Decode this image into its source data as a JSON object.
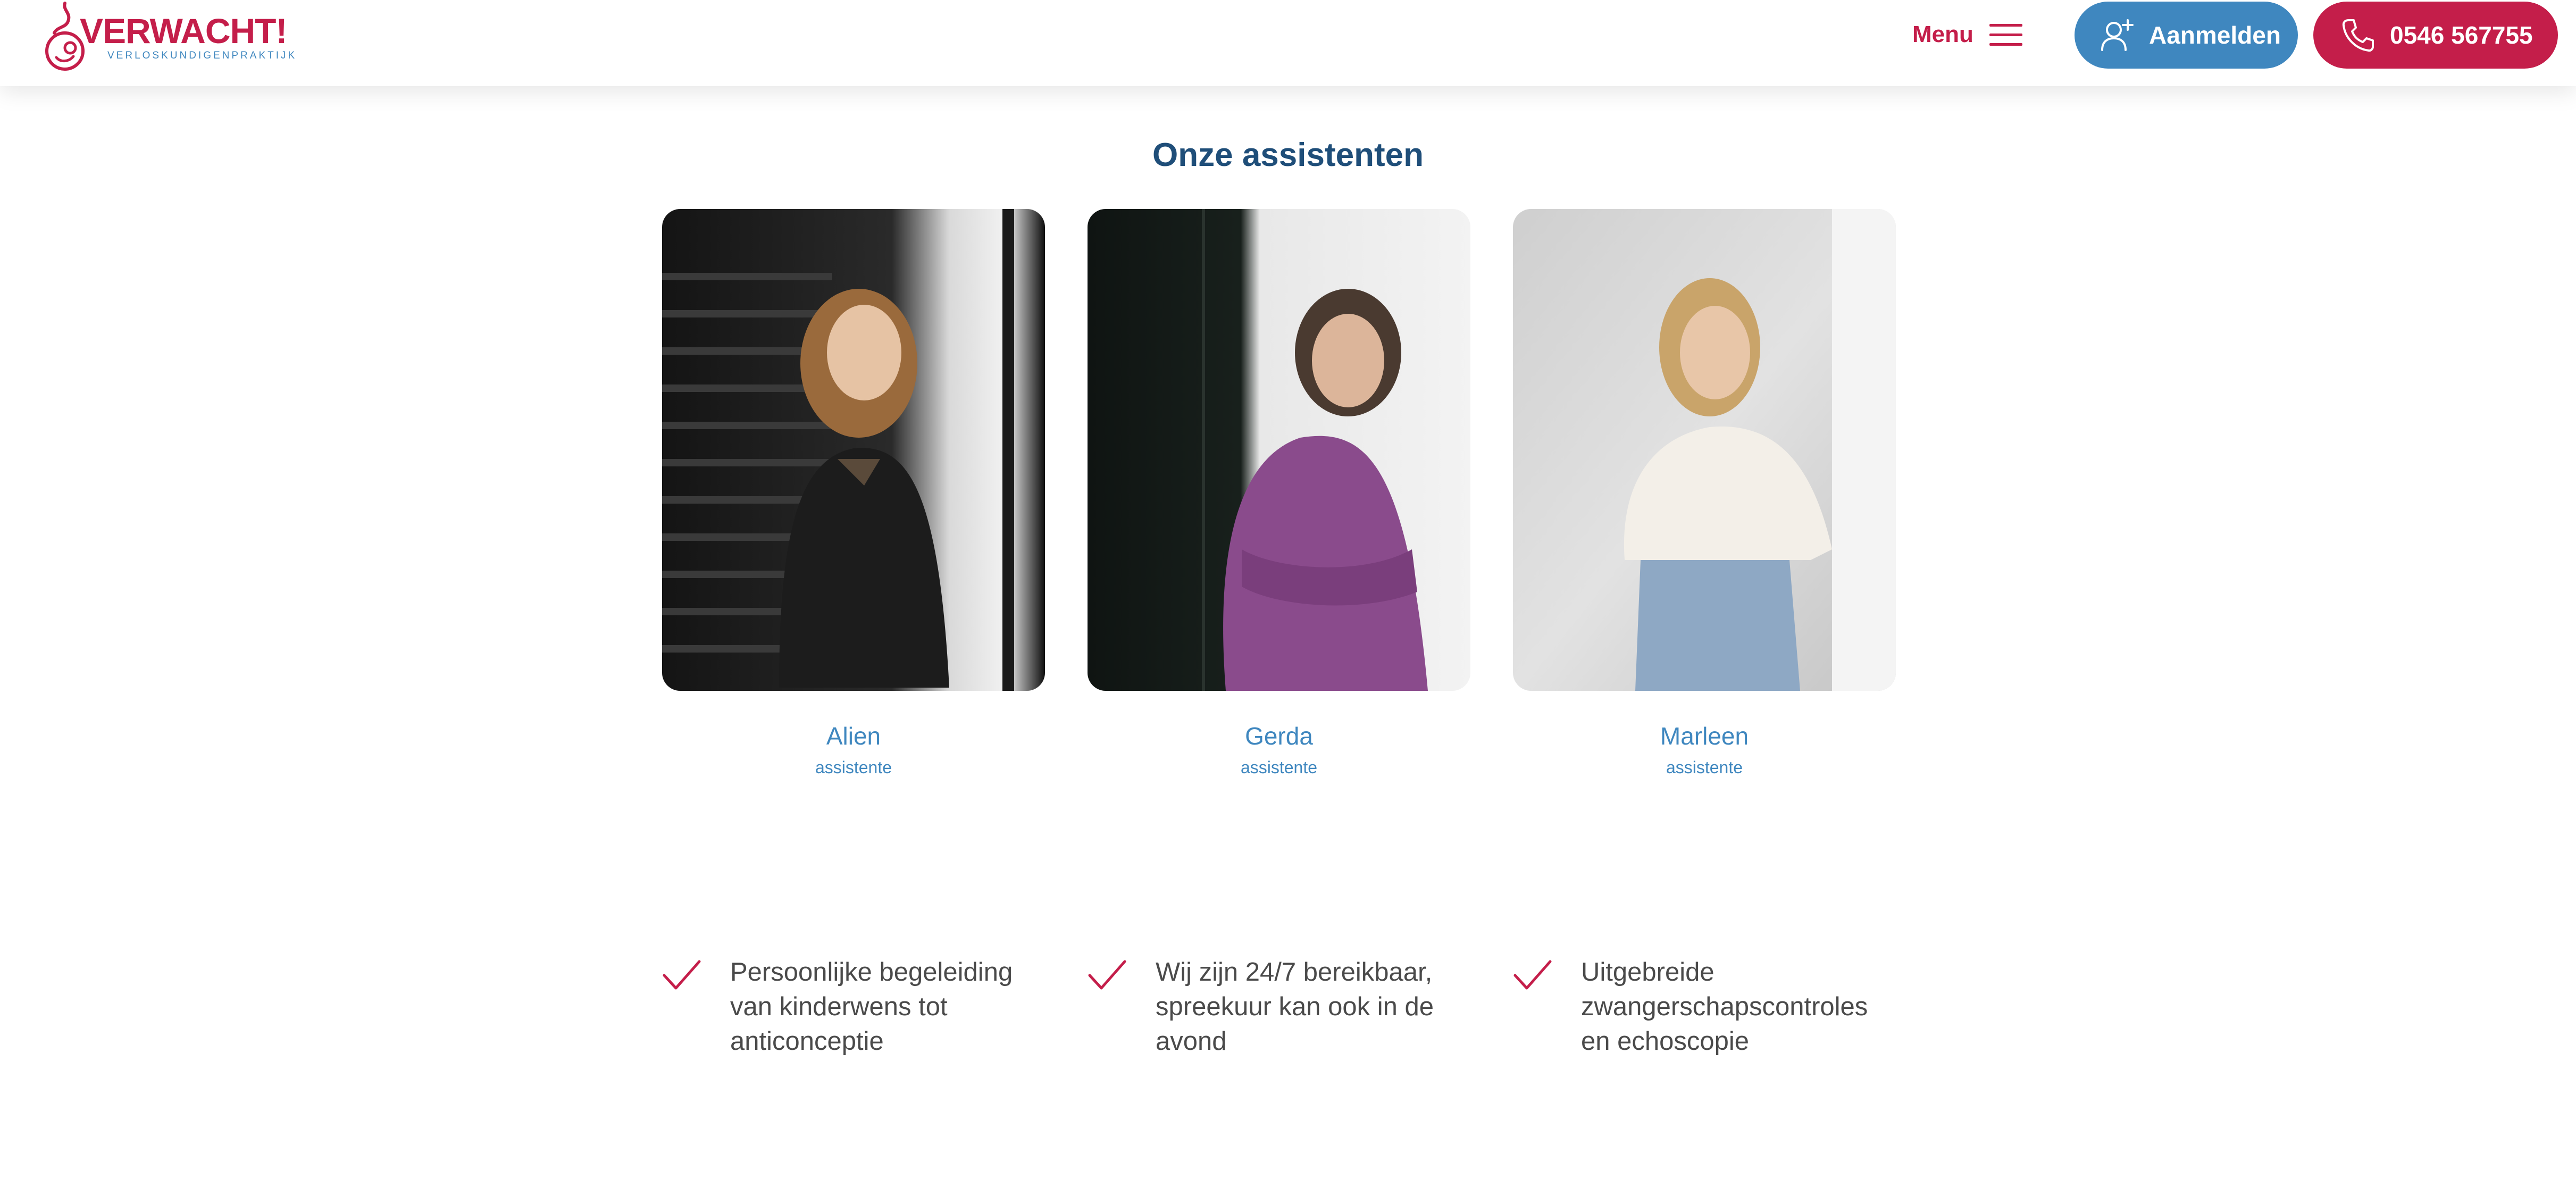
{
  "header": {
    "logo": {
      "wordmark": "VERWACHT!",
      "subtitle": "VERLOSKUNDIGENPRAKTIJK"
    },
    "menu_label": "Menu",
    "register_label": "Aanmelden",
    "phone_label": "0546 567755"
  },
  "main": {
    "title": "Onze assistenten",
    "assistants": [
      {
        "name": "Alien",
        "role": "assistente"
      },
      {
        "name": "Gerda",
        "role": "assistente"
      },
      {
        "name": "Marleen",
        "role": "assistente"
      }
    ],
    "usps": [
      "Persoonlijke begeleiding van kinderwens tot anticonceptie",
      "Wij zijn 24/7 bereikbaar, spreekuur kan ook in de avond",
      "Uitgebreide zwangerschapscontroles en echoscopie"
    ]
  },
  "colors": {
    "brand_red": "#c41e4a",
    "brand_blue": "#3f87bf",
    "title_navy": "#1f4e79"
  },
  "icons": [
    "logo-mark-icon",
    "hamburger-icon",
    "user-plus-icon",
    "phone-icon",
    "check-icon"
  ]
}
